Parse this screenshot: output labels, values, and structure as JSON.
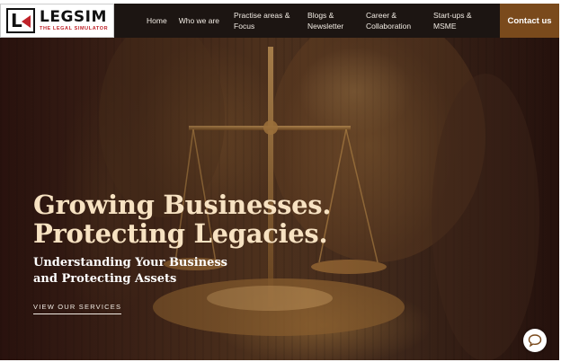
{
  "logo": {
    "name": "LEGSIM",
    "tagline": "THE LEGAL SIMULATOR",
    "mark_letter": "L"
  },
  "nav": {
    "items": [
      {
        "label": "Home"
      },
      {
        "label": "Who we are"
      },
      {
        "label": "Practise areas & Focus"
      },
      {
        "label": "Blogs & Newsletter"
      },
      {
        "label": "Career & Collaboration"
      },
      {
        "label": "Start-ups & MSME"
      }
    ],
    "contact_label": "Contact us"
  },
  "hero": {
    "headline_line1": "Growing Businesses.",
    "headline_line2": "Protecting Legacies.",
    "subline_line1": "Understanding Your Business",
    "subline_line2": "and Protecting Assets",
    "cta_label": "VIEW OUR SERVICES"
  },
  "colors": {
    "header_bg": "#1c1512",
    "contact_bg": "#7a4a1c",
    "headline": "#f7e2c2",
    "brand_red": "#c0232a"
  },
  "icons": {
    "logo_mark": "legsim-logo-icon",
    "chat": "chat-bubble-icon"
  }
}
